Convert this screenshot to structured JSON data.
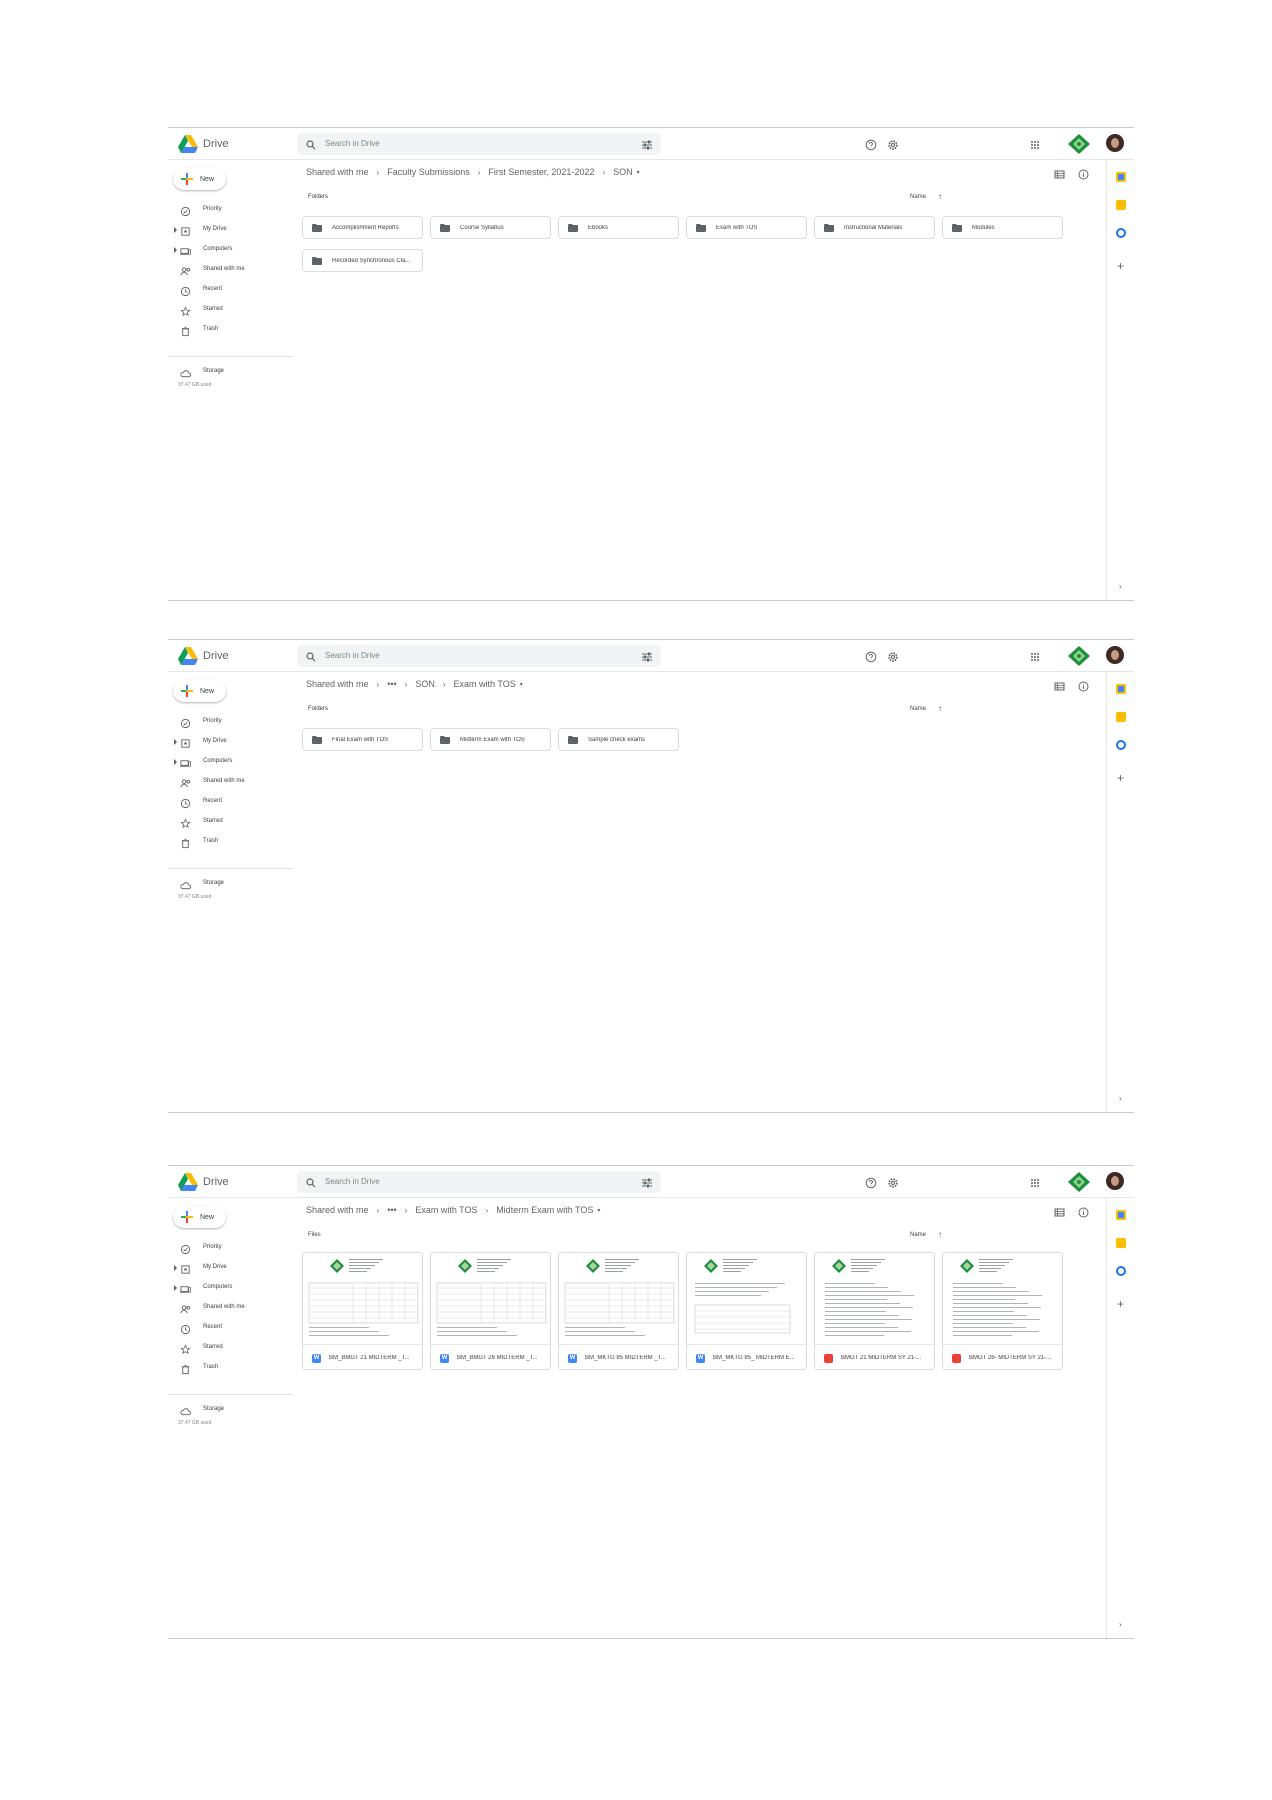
{
  "screens": [
    {
      "app_name": "Drive",
      "search_placeholder": "Search in Drive",
      "new_label": "New",
      "nav": [
        "Priority",
        "My Drive",
        "Computers",
        "Shared with me",
        "Recent",
        "Starred",
        "Trash"
      ],
      "storage_label": "Storage",
      "storage_used": "37.47 GB used",
      "breadcrumbs": [
        "Shared with me",
        "Faculty Submissions",
        "First Semester, 2021-2022",
        "SON"
      ],
      "section_title": "Folders",
      "sort_label": "Name",
      "folders": [
        "Accomplishment Reports",
        "Course Syllabus",
        "Ebooks",
        "Exam with TOS",
        "Instructional Materials",
        "Modules",
        "Recorded Synchronous Cla..."
      ],
      "files": []
    },
    {
      "app_name": "Drive",
      "search_placeholder": "Search in Drive",
      "new_label": "New",
      "nav": [
        "Priority",
        "My Drive",
        "Computers",
        "Shared with me",
        "Recent",
        "Starred",
        "Trash"
      ],
      "storage_label": "Storage",
      "storage_used": "37.47 GB used",
      "breadcrumbs": [
        "Shared with me",
        "•••",
        "SON",
        "Exam with TOS"
      ],
      "section_title": "Folders",
      "sort_label": "Name",
      "folders": [
        "Final Exam with TOS",
        "Midterm Exam with TOS",
        "Sample check exams"
      ],
      "files": []
    },
    {
      "app_name": "Drive",
      "search_placeholder": "Search in Drive",
      "new_label": "New",
      "nav": [
        "Priority",
        "My Drive",
        "Computers",
        "Shared with me",
        "Recent",
        "Starred",
        "Trash"
      ],
      "storage_label": "Storage",
      "storage_used": "37.47 GB used",
      "breadcrumbs": [
        "Shared with me",
        "•••",
        "Exam with TOS",
        "Midterm Exam with TOS"
      ],
      "section_title": "Files",
      "sort_label": "Name",
      "folders": [],
      "files": [
        {
          "name": "BM_BMGT 21 MIDTERM _T...",
          "type": "word",
          "type_glyph": "W"
        },
        {
          "name": "BM_BMGT 26 MIDTERM _T...",
          "type": "word",
          "type_glyph": "W"
        },
        {
          "name": "BM_MKTG 85 MIDTERM _T...",
          "type": "word",
          "type_glyph": "W"
        },
        {
          "name": "BM_MKTG 85_ MIDTERM E...",
          "type": "word",
          "type_glyph": "W"
        },
        {
          "name": "BMGT 21 MIDTERM SY 21-...",
          "type": "pdf",
          "type_glyph": ""
        },
        {
          "name": "BMGT 26- MIDTERM SY 21-...",
          "type": "pdf",
          "type_glyph": ""
        }
      ]
    }
  ],
  "colors": {
    "word": "#4285f4",
    "pdf": "#ea4335",
    "folder": "#5f6368",
    "badge": "#1e8e3e"
  }
}
